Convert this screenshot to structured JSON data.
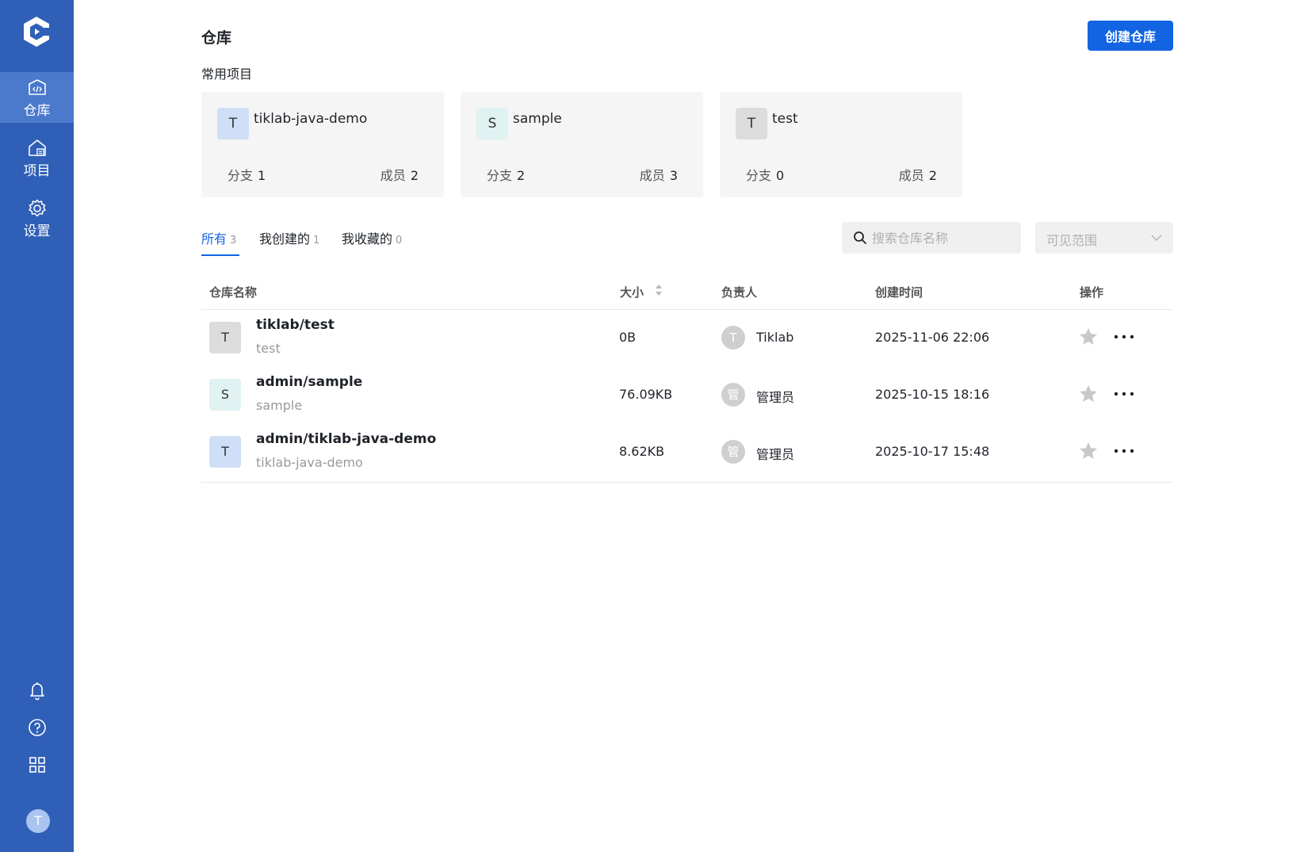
{
  "sidebar": {
    "items": [
      {
        "label": "仓库",
        "icon": "repository-icon",
        "active": true
      },
      {
        "label": "项目",
        "icon": "project-icon",
        "active": false
      },
      {
        "label": "设置",
        "icon": "gear-icon",
        "active": false
      }
    ],
    "tools": [
      "bell-icon",
      "help-icon",
      "apps-grid-icon"
    ],
    "avatar_letter": "T"
  },
  "header": {
    "title": "仓库",
    "create_label": "创建仓库"
  },
  "frequent": {
    "title": "常用项目",
    "branch_label": "分支",
    "member_label": "成员",
    "cards": [
      {
        "letter": "T",
        "name": "tiklab-java-demo",
        "branches": "1",
        "members": "2",
        "color": "#cfdff8"
      },
      {
        "letter": "S",
        "name": "sample",
        "branches": "2",
        "members": "3",
        "color": "#e0f2f1"
      },
      {
        "letter": "T",
        "name": "test",
        "branches": "0",
        "members": "2",
        "color": "#dcdcdc"
      }
    ]
  },
  "tabs": [
    {
      "label": "所有",
      "count": "3",
      "active": true
    },
    {
      "label": "我创建的",
      "count": "1",
      "active": false
    },
    {
      "label": "我收藏的",
      "count": "0",
      "active": false
    }
  ],
  "search": {
    "placeholder": "搜索仓库名称"
  },
  "scope": {
    "label": "可见范围"
  },
  "table": {
    "columns": [
      "仓库名称",
      "大小",
      "负责人",
      "创建时间",
      "操作"
    ],
    "rows": [
      {
        "letter": "T",
        "name": "tiklab/test",
        "desc": "test",
        "size": "0B",
        "owner_letter": "T",
        "owner": "Tiklab",
        "time": "2025-11-06 22:06",
        "color": "#dcdcdc"
      },
      {
        "letter": "S",
        "name": "admin/sample",
        "desc": "sample",
        "size": "76.09KB",
        "owner_letter": "管",
        "owner": "管理员",
        "time": "2025-10-15 18:16",
        "color": "#e0f2f1"
      },
      {
        "letter": "T",
        "name": "admin/tiklab-java-demo",
        "desc": "tiklab-java-demo",
        "size": "8.62KB",
        "owner_letter": "管",
        "owner": "管理员",
        "time": "2025-10-17 15:48",
        "color": "#cfdff8"
      }
    ]
  },
  "colors": {
    "sidebar": "#2f5fb7",
    "sidebar_active": "#4b79cc",
    "primary": "#1264e3"
  }
}
